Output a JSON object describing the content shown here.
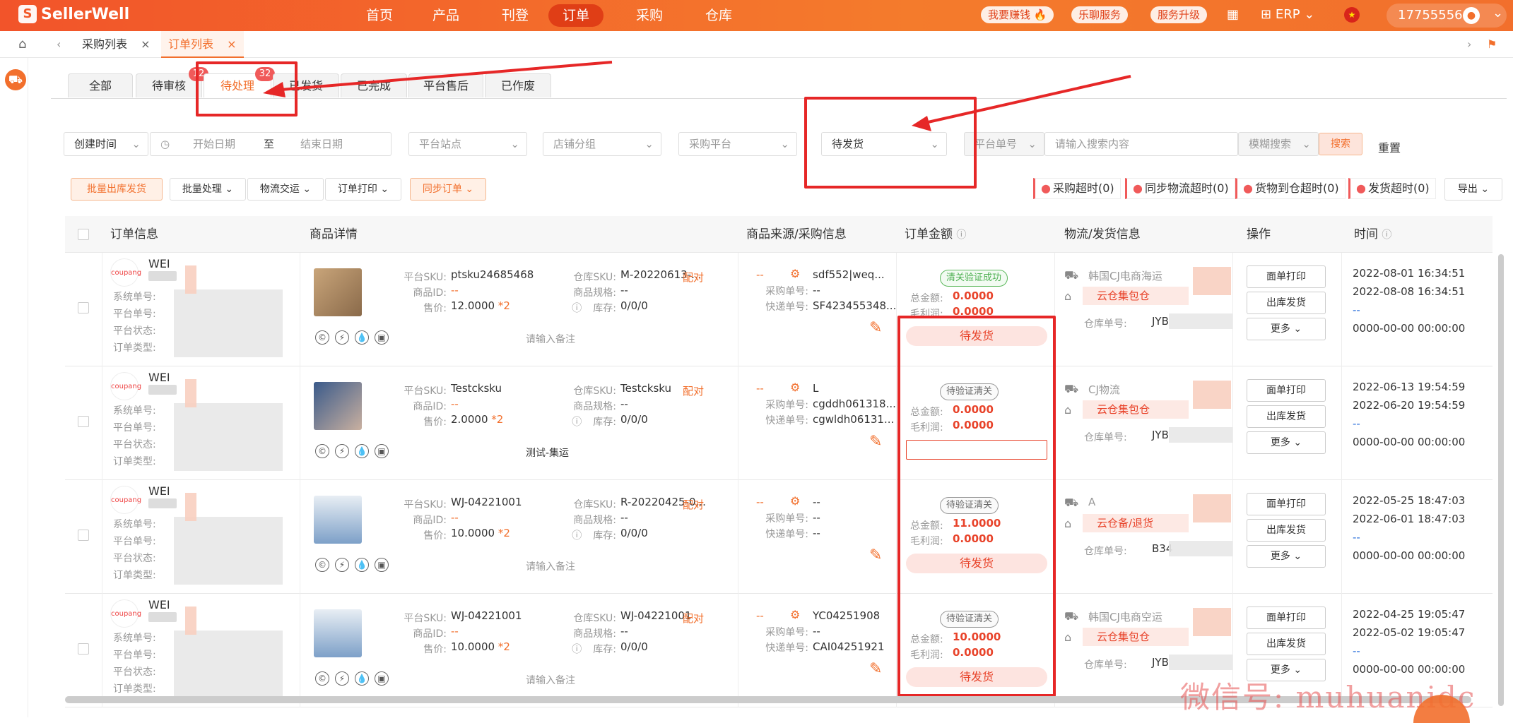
{
  "app": {
    "logo_text": "SellerWell"
  },
  "nav": {
    "items": [
      "首页",
      "产品",
      "刊登",
      "订单",
      "采购",
      "仓库"
    ],
    "active": "订单"
  },
  "top_right": {
    "pills": [
      "我要赚钱",
      "乐聊服务",
      "服务升级"
    ],
    "erp": "ERP",
    "user": "17755556..."
  },
  "tabs": {
    "items": [
      "采购列表",
      "订单列表"
    ],
    "active": "订单列表"
  },
  "status_tabs": {
    "items": [
      "全部",
      "待审核",
      "待处理",
      "已发货",
      "已完成",
      "平台售后",
      "已作废"
    ],
    "active": "待处理",
    "badges": {
      "待审核": "12",
      "待处理": "32"
    }
  },
  "filters": {
    "time_type": "创建时间",
    "start_placeholder": "开始日期",
    "to": "至",
    "end_placeholder": "结束日期",
    "site_placeholder": "平台站点",
    "store_placeholder": "店铺分组",
    "purchase_placeholder": "采购平台",
    "status_value": "待发货",
    "order_no_type": "平台单号",
    "search_placeholder": "请输入搜索内容",
    "fuzzy": "模糊搜索",
    "search_button": "搜索",
    "reset": "重置"
  },
  "actions": {
    "bulk_ship": "批量出库发货",
    "bulk_process": "批量处理",
    "logistics": "物流交运",
    "print": "订单打印",
    "sync": "同步订单",
    "export": "导出"
  },
  "timeouts": [
    "采购超时(0)",
    "同步物流超时(0)",
    "货物到仓超时(0)",
    "发货超时(0)"
  ],
  "columns": [
    "订单信息",
    "商品详情",
    "商品来源/采购信息",
    "订单金额",
    "物流/发货信息",
    "操作",
    "时间"
  ],
  "labels": {
    "sys_no": "系统单号:",
    "plat_no": "平台单号:",
    "plat_status": "平台状态:",
    "order_type": "订单类型:",
    "plat_sku": "平台SKU:",
    "item_id": "商品ID:",
    "price": "售价:",
    "wh_sku": "仓库SKU:",
    "spec": "商品规格:",
    "stock": "库存:",
    "pair": "配对",
    "purchase_no": "采购单号:",
    "express_no": "快递单号:",
    "total": "总金额:",
    "profit": "毛利润:",
    "wh_no": "仓库单号:",
    "print": "面单打印",
    "ship": "出库发货",
    "more": "更多",
    "note_placeholder": "请输入备注",
    "store_name": "WEI",
    "shop": "coupang"
  },
  "orders": [
    {
      "sku": "ptsku24685468",
      "id": "--",
      "price": "12.0000",
      "qty": "*2",
      "wh_sku": "M-20220613-...",
      "spec": "--",
      "stock": "0/0/0",
      "note": "请输入备注",
      "src1": "--",
      "src2": "sdf552|weq...",
      "pno": "--",
      "eno": "SF423455348...",
      "tag": "清关验证成功",
      "total": "0.0000",
      "profit": "0.0000",
      "pending": "待发货",
      "carrier": "韩国CJ电商海运",
      "wh": "云仓集包仓",
      "whno": "JYB",
      "t1": "2022-08-01 16:34:51",
      "t2": "2022-08-08 16:34:51",
      "t3": "--",
      "t4": "0000-00-00 00:00:00"
    },
    {
      "sku": "Testcksku",
      "id": "--",
      "price": "2.0000",
      "qty": "*2",
      "wh_sku": "Testcksku",
      "spec": "--",
      "stock": "0/0/0",
      "note": "测试-集运",
      "src1": "--",
      "src2": "L",
      "pno": "cgddh061318...",
      "eno": "cgwldh06131...",
      "tag": "待验证清关",
      "total": "0.0000",
      "profit": "0.0000",
      "pending": "",
      "carrier": "CJ物流",
      "wh": "云仓集包仓",
      "whno": "JYB",
      "t1": "2022-06-13 19:54:59",
      "t2": "2022-06-20 19:54:59",
      "t3": "--",
      "t4": "0000-00-00 00:00:00"
    },
    {
      "sku": "WJ-04221001",
      "id": "--",
      "price": "10.0000",
      "qty": "*2",
      "wh_sku": "R-20220425-0...",
      "spec": "--",
      "stock": "0/0/0",
      "note": "请输入备注",
      "src1": "--",
      "src2": "--",
      "pno": "--",
      "eno": "--",
      "tag": "待验证清关",
      "total": "11.0000",
      "profit": "0.0000",
      "pending": "待发货",
      "carrier": "A",
      "wh": "云仓备/退货",
      "whno": "B34",
      "t1": "2022-05-25 18:47:03",
      "t2": "2022-06-01 18:47:03",
      "t3": "--",
      "t4": "0000-00-00 00:00:00"
    },
    {
      "sku": "WJ-04221001",
      "id": "--",
      "price": "10.0000",
      "qty": "*2",
      "wh_sku": "WJ-04221001",
      "spec": "--",
      "stock": "0/0/0",
      "note": "请输入备注",
      "src1": "--",
      "src2": "YC04251908",
      "pno": "--",
      "eno": "CAI04251921",
      "tag": "待验证清关",
      "total": "10.0000",
      "profit": "0.0000",
      "pending": "待发货",
      "carrier": "韩国CJ电商空运",
      "wh": "云仓集包仓",
      "whno": "JYB",
      "t1": "2022-04-25 19:05:47",
      "t2": "2022-05-02 19:05:47",
      "t3": "--",
      "t4": "0000-00-00 00:00:00"
    }
  ],
  "watermark": "微信号: muhuanidc",
  "colors": {
    "brand": "#f26f2c",
    "annotation": "#e62727"
  }
}
